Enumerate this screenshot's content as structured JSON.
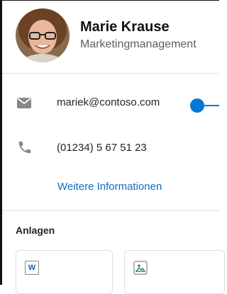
{
  "contact": {
    "name": "Marie Krause",
    "department": "Marketingmanagement",
    "email": "mariek@contoso.com",
    "phone": "(01234) 5 67 51 23",
    "more_info_link": "Weitere Informationen"
  },
  "attachments": {
    "title": "Anlagen",
    "items": [
      {
        "icon": "word-document-icon",
        "badge": "W"
      },
      {
        "icon": "image-file-icon"
      }
    ]
  },
  "colors": {
    "accent": "#0078d4",
    "link": "#0f6cbd",
    "secondary_text": "#605e5c",
    "icon_gray": "#8a8886"
  }
}
